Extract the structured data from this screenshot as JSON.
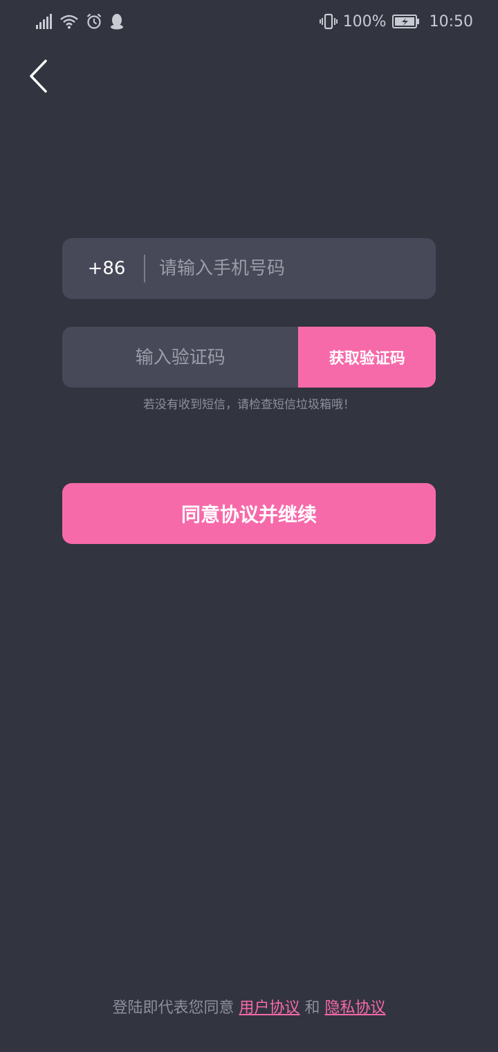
{
  "status_bar": {
    "battery_percent": "100%",
    "time": "10:50",
    "icons_left": [
      "signal-icon",
      "wifi-icon",
      "alarm-icon",
      "qq-icon"
    ],
    "icons_right": [
      "vibrate-icon",
      "battery-charging-icon"
    ]
  },
  "nav": {
    "back_icon": "chevron-left-icon"
  },
  "phone": {
    "country_code": "+86",
    "placeholder": "请输入手机号码"
  },
  "code": {
    "placeholder": "输入验证码",
    "get_code_label": "获取验证码",
    "hint": "若没有收到短信，请检查短信垃圾箱哦！"
  },
  "continue_label": "同意协议并继续",
  "footer": {
    "prefix": "登陆即代表您同意",
    "user_agreement": "用户协议",
    "and": "和",
    "privacy_agreement": "隐私协议"
  },
  "colors": {
    "background": "#323440",
    "field": "#474959",
    "accent": "#f76aaa",
    "muted_text": "#8d8f9c"
  }
}
